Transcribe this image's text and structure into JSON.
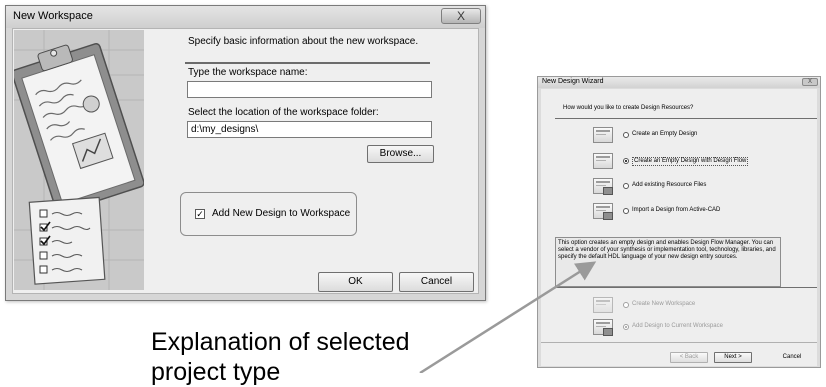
{
  "workspace_dialog": {
    "title": "New Workspace",
    "close_label": "X",
    "intro": "Specify basic information about the new workspace.",
    "name_label": "Type the workspace name:",
    "name_value": "",
    "location_label": "Select the location of the workspace folder:",
    "location_value": "d:\\my_designs\\",
    "browse_label": "Browse...",
    "add_design_label": "Add New Design to Workspace",
    "add_design_checked": true,
    "ok_label": "OK",
    "cancel_label": "Cancel"
  },
  "design_wizard": {
    "title": "New Design Wizard",
    "close_label": "X",
    "question": "How would you like to create Design Resources?",
    "options": [
      {
        "label": "Create an Empty Design",
        "selected": false,
        "enabled": true
      },
      {
        "label": "Create an Empty Design with Design Flow",
        "selected": true,
        "enabled": true
      },
      {
        "label": "Add existing Resource Files",
        "selected": false,
        "enabled": true
      },
      {
        "label": "Import a Design from Active-CAD",
        "selected": false,
        "enabled": true
      }
    ],
    "description": "This option creates an empty design and enables Design Flow Manager. You can select a vendor of your synthesis or implementation tool, technology, libraries, and specify the default HDL language of your new design entry sources.",
    "workspace_options": [
      {
        "label": "Create New Workspace",
        "selected": false,
        "enabled": false
      },
      {
        "label": "Add Design to Current Workspace",
        "selected": true,
        "enabled": false
      }
    ],
    "back_label": "< Back",
    "next_label": "Next >",
    "cancel_label": "Cancel"
  },
  "caption": {
    "line1": "Explanation of selected",
    "line2": "project type"
  }
}
